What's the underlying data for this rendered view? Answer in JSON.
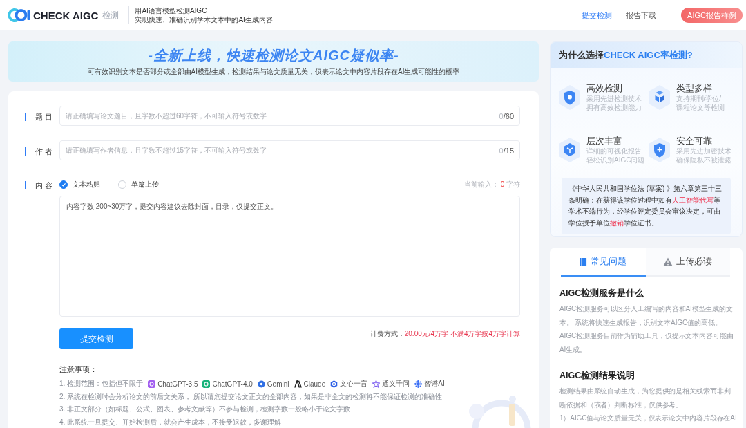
{
  "header": {
    "brand": "CHECK AIGC",
    "brand_suffix": "检测",
    "tagline": [
      "用AI语言模型检测AIGC",
      "实现快速、准确识别学术文本中的AI生成内容"
    ],
    "nav": [
      {
        "label": "提交检测",
        "selected": true
      },
      {
        "label": "报告下载",
        "selected": false
      }
    ],
    "cta_button": "AIGC报告样例"
  },
  "banner": {
    "title": "-全新上线，快速检测论文AIGC疑似率-",
    "subtitle": "可有效识别文本是否部分或全部由AI模型生成，检测结果与论文质量无关，仅表示论文中内容片段存在AI生成可能性的概率"
  },
  "form": {
    "fields": [
      {
        "label": "题 目",
        "placeholder": "请正确填写论文题目，且字数不超过60字符，不可输入符号或数字",
        "count": "0",
        "limit": "/60"
      },
      {
        "label": "作 者",
        "placeholder": "请正确填写作者信息，且字数不超过15字符，不可输入符号或数字",
        "count": "0",
        "limit": "/15"
      }
    ],
    "content": {
      "label": "内 容",
      "modes": [
        {
          "label": "文本粘贴",
          "selected": true
        },
        {
          "label": "单篇上传",
          "selected": false
        }
      ],
      "count_label": "当前输入：",
      "count": "0",
      "count_unit": "字符",
      "placeholder": "内容字数 200~30万字，提交内容建议去除封面，目录，仅提交正文。"
    },
    "submit_button": "提交检测",
    "pricing": {
      "label": "计费方式：",
      "value": "20.00元/4万字 不满4万字按4万字计算"
    },
    "notes": {
      "title": "注意事项：",
      "items": [
        {
          "text": "1. 检测范围：包括但不限于",
          "models": [
            {
              "name": "ChatGPT-3.5",
              "kind": "tile",
              "color": "#a25ef0"
            },
            {
              "name": "ChatGPT-4.0",
              "kind": "tile",
              "color": "#19b27a"
            },
            {
              "name": "Gemini",
              "kind": "ring",
              "color": "#2f6fe4"
            },
            {
              "name": "Claude",
              "kind": "slashes",
              "color": "#222222"
            },
            {
              "name": "文心一言",
              "kind": "hexagon",
              "color": "#2c5fe6"
            },
            {
              "name": "通义千问",
              "kind": "star",
              "color": "#7b5cf0"
            },
            {
              "name": "智谱AI",
              "kind": "burst",
              "color": "#3b6ff5"
            }
          ]
        },
        {
          "text": "2. 系统在检测时会分析论文的前后文关系， 所以请您提交论文正文的全部内容，如果是非全文的检测将不能保证检测的准确性"
        },
        {
          "text": "3. 非正文部分（如标题、公式、图表、参考文献等）不参与检测，检测字数一般略小于论文字数"
        },
        {
          "text": "4. 此系统一旦提交、开始检测后，就会产生成本，不接受退款，多谢理解"
        }
      ]
    }
  },
  "why": {
    "title": [
      {
        "text": "为什么选择",
        "highlight": false
      },
      {
        "text": "CHECK AIGC率检测?",
        "highlight": true
      }
    ],
    "features": [
      {
        "title": "高效检测",
        "description": [
          "采用先进检测技术",
          "拥有高效检测能力"
        ],
        "kind": "shield"
      },
      {
        "title": "类型多样",
        "description": [
          "支持期刊/学位/",
          "课程论文等检测"
        ],
        "kind": "cubes"
      },
      {
        "title": "层次丰富",
        "description": [
          "详细的可视化报告",
          "轻松识别AIGC问题"
        ],
        "kind": "cube"
      },
      {
        "title": "安全可靠",
        "description": [
          "采用先进加密技术",
          "确保隐私不被泄露"
        ],
        "kind": "shield_plus"
      }
    ],
    "law_note": [
      {
        "text": "《中华人民共和国学位法 (草案) 》第六章第三十三条明确：在获得该学位过程中如有",
        "highlight": false
      },
      {
        "text": "人工智能代写",
        "highlight": true
      },
      {
        "text": "等学术不端行为，经学位评定委员会审议决定，可由学位授予单位",
        "highlight": false
      },
      {
        "text": "撤销",
        "highlight": true
      },
      {
        "text": "学位证书。",
        "highlight": false
      }
    ]
  },
  "faq": {
    "tabs": [
      {
        "label": "常见问题",
        "selected": true,
        "kind": "book"
      },
      {
        "label": "上传必读",
        "selected": false,
        "kind": "warning"
      }
    ],
    "sections": [
      {
        "heading": "AIGC检测服务是什么",
        "paragraphs": [
          "AIGC检测服务可以区分人工编写的内容和AI模型生成的文本。 系统将快速生成报告，识别文本AIGC值的高低。AIGC检测服务目前作为辅助工具，仅提示文本内容可能由AI生成。"
        ]
      },
      {
        "heading": "AIGC检测结果说明",
        "paragraphs": [
          "检测结果由系统自动生成，为您提供的是相关线索而非判断依据和（或者）判断标准，仅供参考。",
          "1）AIGC值与论文质量无关，仅表示论文中内容片段存在AI"
        ]
      }
    ]
  }
}
